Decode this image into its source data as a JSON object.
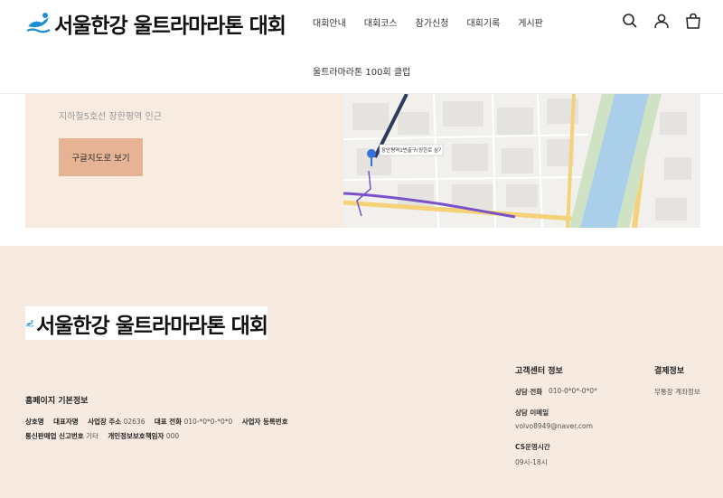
{
  "header": {
    "logo_text": "서울한강 울트라마라톤 대회",
    "nav": [
      "대회안내",
      "대회코스",
      "참가신청",
      "대회기록",
      "게시판"
    ],
    "nav_second_row": "울트라마라톤 100회 클럽",
    "icons": [
      "search-icon",
      "user-icon",
      "shopping-bag-icon"
    ]
  },
  "location": {
    "subway_text": "지하철5호선 장한평역 인근",
    "map_button": "구글지도로 보기",
    "map_label": "장안평역1번출구(장한로 삼거"
  },
  "footer": {
    "logo_text": "서울한강 울트라마라톤 대회",
    "basic_info_title": "홈페이지 기본정보",
    "row1": [
      {
        "label": "상호명",
        "value": ""
      },
      {
        "label": "대표자명",
        "value": ""
      },
      {
        "label": "사업장 주소",
        "value": "02636"
      },
      {
        "label": "대표 전화",
        "value": "010-*0*0-*0*0"
      },
      {
        "label": "사업자 등록번호",
        "value": ""
      }
    ],
    "row2": [
      {
        "label": "통신판매업 신고번호",
        "value": "기타"
      },
      {
        "label": "개인정보보호책임자",
        "value": "000"
      }
    ],
    "cs": {
      "title": "고객센터 정보",
      "phone_label": "상담 전화",
      "phone_value": "010-0*0*-0*0*",
      "email_label": "상담 이메일",
      "email_value": "volvo8949@naver.com",
      "hours_label": "CS운영시간",
      "hours_value": "09시-18시"
    },
    "payment": {
      "title": "결제정보",
      "value": "무통장 계좌정보"
    }
  }
}
